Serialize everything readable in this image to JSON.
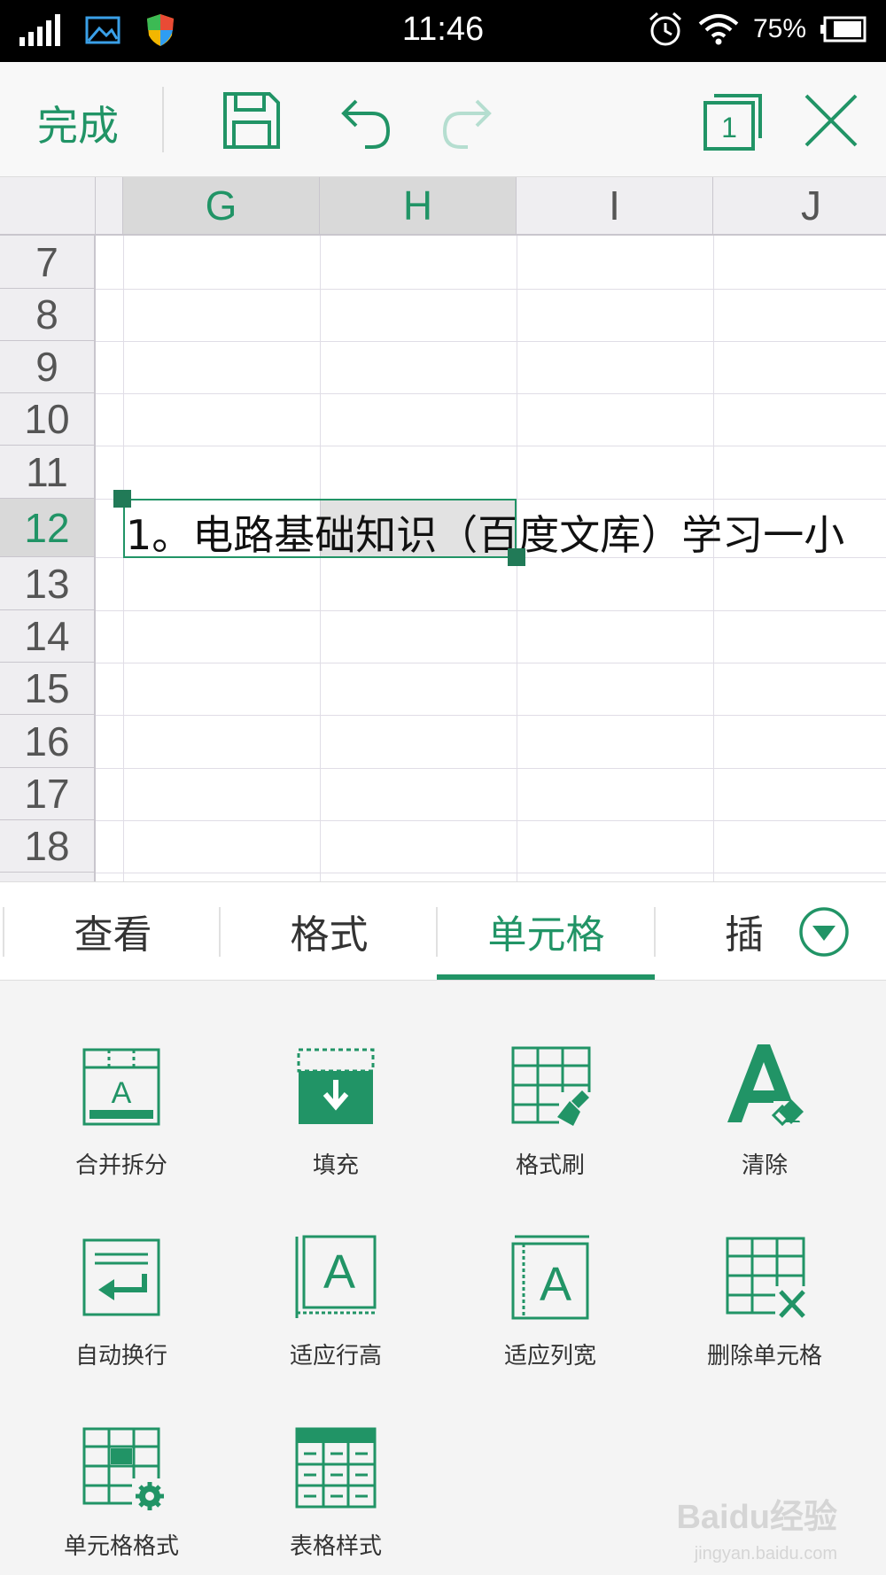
{
  "status_bar": {
    "time": "11:46",
    "battery": "75%",
    "icons": [
      "signal-icon",
      "image-icon",
      "shield-icon",
      "alarm-icon",
      "wifi-icon",
      "battery-icon"
    ]
  },
  "toolbar": {
    "done_label": "完成",
    "icons": [
      "save-icon",
      "undo-icon",
      "redo-icon",
      "window-count-icon",
      "close-icon"
    ],
    "window_count": "1",
    "accent_color": "#219466"
  },
  "sheet": {
    "columns": [
      "G",
      "H",
      "I",
      "J"
    ],
    "selected_columns": [
      "G",
      "H"
    ],
    "rows": [
      "7",
      "8",
      "9",
      "10",
      "11",
      "12",
      "13",
      "14",
      "15",
      "16",
      "17",
      "18"
    ],
    "selected_row": "12",
    "cell_text": "1。电路基础知识（百度文库）学习一小"
  },
  "tabs": [
    {
      "label": "查看"
    },
    {
      "label": "格式"
    },
    {
      "label": "单元格"
    },
    {
      "label": "插"
    }
  ],
  "active_tab": "单元格",
  "tools": [
    {
      "label": "合并拆分",
      "icon": "merge-split-icon"
    },
    {
      "label": "填充",
      "icon": "fill-icon"
    },
    {
      "label": "格式刷",
      "icon": "format-painter-icon"
    },
    {
      "label": "清除",
      "icon": "clear-icon"
    },
    {
      "label": "自动换行",
      "icon": "wrap-text-icon"
    },
    {
      "label": "适应行高",
      "icon": "fit-row-height-icon"
    },
    {
      "label": "适应列宽",
      "icon": "fit-column-width-icon"
    },
    {
      "label": "删除单元格",
      "icon": "delete-cell-icon"
    },
    {
      "label": "单元格格式",
      "icon": "cell-format-icon"
    },
    {
      "label": "表格样式",
      "icon": "table-style-icon"
    }
  ],
  "watermark": {
    "text": "Baidu经验",
    "sub": "jingyan.baidu.com"
  }
}
